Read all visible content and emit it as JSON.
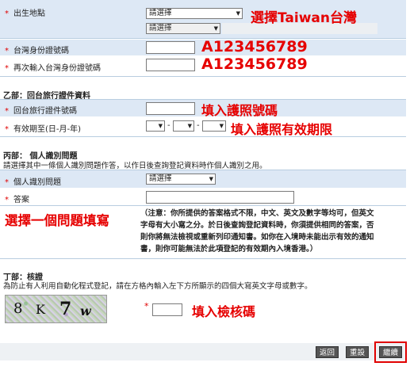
{
  "birthplace": {
    "label": "出生地點",
    "select1": "請選擇",
    "select2": "請選擇",
    "annotation": "選擇Taiwan台灣"
  },
  "tw_id": {
    "label": "台灣身份證號碼",
    "annotation": "A123456789"
  },
  "tw_id_confirm": {
    "label": "再次輸入台灣身份證號碼",
    "annotation": "A123456789"
  },
  "section_b": {
    "title": "乙部：回台旅行證件資料",
    "doc_no_label": "回台旅行證件號碼",
    "doc_no_annotation": "填入護照號碼",
    "expiry_label": "有效期至(日-月-年)",
    "expiry_sep1": "-",
    "expiry_sep2": "-",
    "expiry_annotation": "填入護照有效期限"
  },
  "section_c": {
    "title": "丙部： 個人識別問題",
    "description": "請選擇其中一條個人識別問題作答，以作日後查詢登記資料時作個人識別之用。",
    "question_label": "個人識別問題",
    "question_select": "請選擇",
    "answer_label": "答案",
    "annotation": "選擇一個問題填寫",
    "note_lines": [
      "（注意：你所提供的答案格式不限，中文、英文及數字等均可，但英文",
      "字母有大小寫之分。於日後查詢登記資料時，你須提供相同的答案，否",
      "則你將無法檢視或重新列印通知書。如你在入境時未能出示有效的通知",
      "書，則你可能無法於此項登記的有效期內入境香港。）"
    ]
  },
  "section_d": {
    "title": "丁部：核證",
    "description": "為防止有人利用自動化程式登記，請在方格內輸入左下方所顯示的四個大寫英文字母或數字。",
    "captcha_chars": [
      "8",
      "K",
      "7",
      "w"
    ],
    "annotation": "填入檢核碼"
  },
  "buttons": {
    "back": "返回",
    "reset": "重設",
    "continue": "繼續"
  },
  "colors": {
    "annotation_red": "#e60000",
    "row_blue": "#dde8f5",
    "button_gray": "#555555",
    "highlight_border": "#e00000"
  }
}
